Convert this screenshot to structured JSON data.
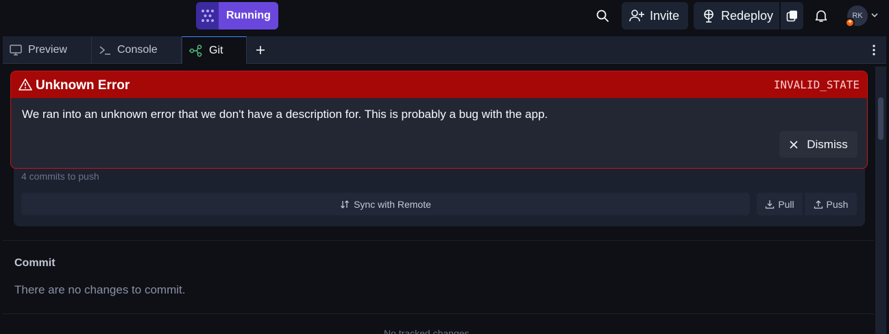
{
  "header": {
    "run_label": "Running",
    "invite_label": "Invite",
    "redeploy_label": "Redeploy",
    "avatar_initials": "RK",
    "avatar_badge": "+"
  },
  "tabs": [
    {
      "label": "Preview",
      "icon": "monitor-icon"
    },
    {
      "label": "Console",
      "icon": "terminal-icon"
    },
    {
      "label": "Git",
      "icon": "git-branch-icon",
      "active": true
    }
  ],
  "git": {
    "commits_to_push": "4 commits to push",
    "sync_label": "Sync with Remote",
    "pull_label": "Pull",
    "push_label": "Push",
    "commit_heading": "Commit",
    "commit_empty": "There are no changes to commit.",
    "bottom_hint": "No tracked changes"
  },
  "error": {
    "title": "Unknown Error",
    "code": "INVALID_STATE",
    "message": "We ran into an unknown error that we don't have a description for. This is probably a bug with the app.",
    "dismiss_label": "Dismiss"
  },
  "colors": {
    "background": "#0e1016",
    "run_accent": "#6a47dc",
    "error_header": "#a60808",
    "error_border": "#c71414",
    "git_icon": "#4fbf7f",
    "active_tab_border": "#3d8bff"
  }
}
